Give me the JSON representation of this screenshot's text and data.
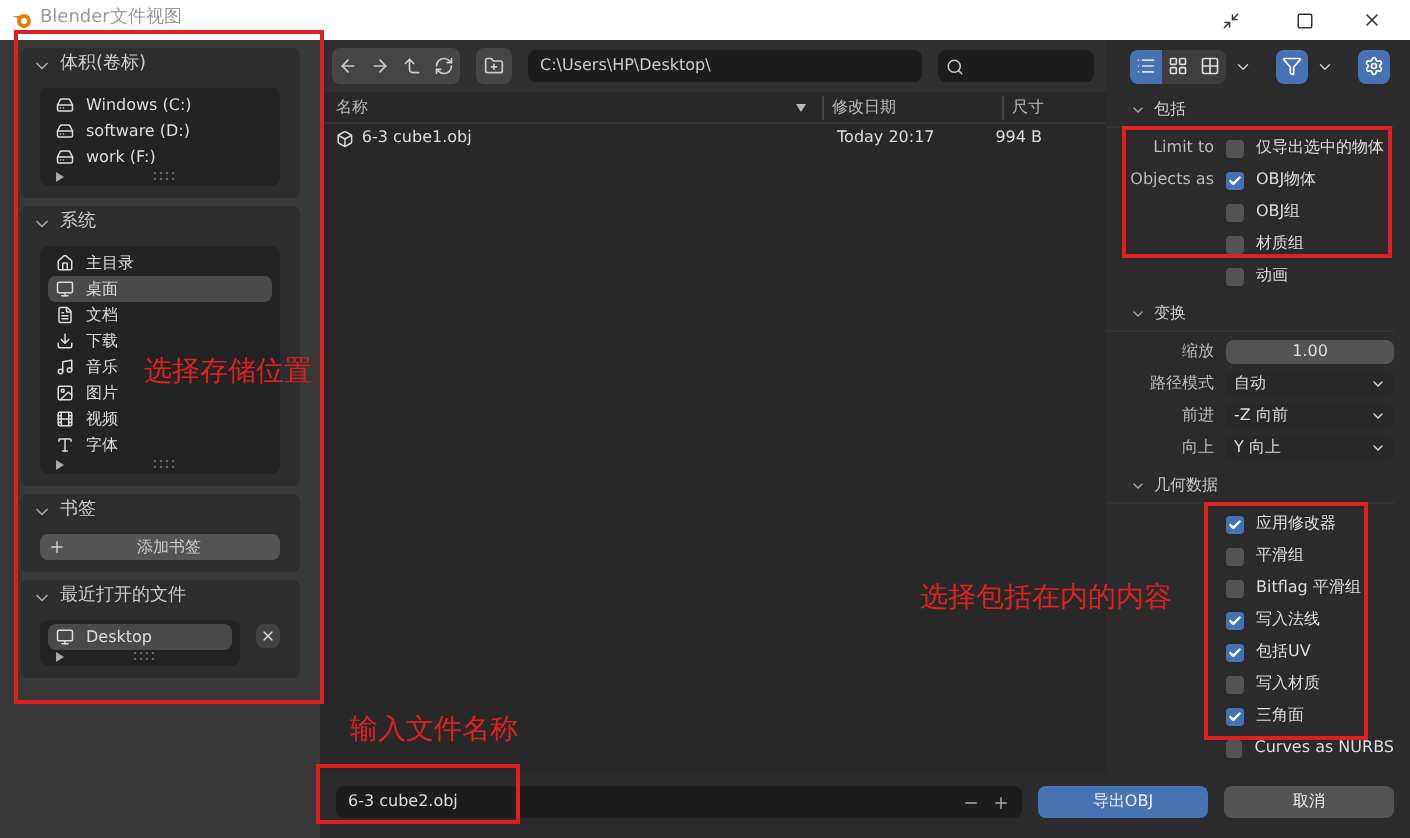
{
  "window": {
    "title": "Blender文件视图"
  },
  "sidebar": {
    "sections": [
      {
        "kind": "list",
        "title": "体积(卷标)",
        "expanded": true,
        "items": [
          {
            "label": "Windows (C:)",
            "selected": false
          },
          {
            "label": "software (D:)",
            "selected": false
          },
          {
            "label": "work (F:)",
            "selected": false
          }
        ]
      },
      {
        "kind": "list",
        "title": "系统",
        "expanded": true,
        "items": [
          {
            "label": "主目录",
            "selected": false
          },
          {
            "label": "桌面",
            "selected": true
          },
          {
            "label": "文档",
            "selected": false
          },
          {
            "label": "下载",
            "selected": false
          },
          {
            "label": "音乐",
            "selected": false
          },
          {
            "label": "图片",
            "selected": false
          },
          {
            "label": "视频",
            "selected": false
          },
          {
            "label": "字体",
            "selected": false
          }
        ]
      },
      {
        "kind": "button",
        "title": "书签",
        "expanded": true,
        "button": "添加书签"
      },
      {
        "kind": "recent",
        "title": "最近打开的文件",
        "expanded": true,
        "items": [
          {
            "label": "Desktop",
            "selected": true
          }
        ]
      }
    ]
  },
  "toolbar": {
    "path": "C:\\Users\\HP\\Desktop\\",
    "view_modes": [
      {
        "kind": "list",
        "selected": true
      },
      {
        "kind": "thumbs-small",
        "selected": false
      },
      {
        "kind": "thumbs",
        "selected": false
      }
    ],
    "filter_on": true
  },
  "table": {
    "columns": [
      "名称",
      "修改日期",
      "尺寸"
    ],
    "rows": [
      [
        "6-3 cube1.obj",
        "Today 20:17",
        "994 B"
      ]
    ]
  },
  "footer": {
    "filename": "6-3 cube2.obj",
    "buttons": [
      {
        "label": "导出OBJ",
        "kind": "primary"
      },
      {
        "label": "取消",
        "kind": "secondary"
      }
    ]
  },
  "options": [
    {
      "title": "包括",
      "rows": [
        {
          "kind": "check",
          "label": "Limit to",
          "text": "仅导出选中的物体",
          "checked": false
        },
        {
          "kind": "check",
          "label": "Objects as",
          "text": "OBJ物体",
          "checked": true
        },
        {
          "kind": "check",
          "text": "OBJ组",
          "checked": false
        },
        {
          "kind": "check",
          "text": "材质组",
          "checked": false
        },
        {
          "kind": "check",
          "text": "动画",
          "checked": false
        }
      ]
    },
    {
      "title": "变换",
      "rows": [
        {
          "kind": "number",
          "label": "缩放",
          "value": "1.00"
        },
        {
          "kind": "select",
          "label": "路径模式",
          "value": "自动"
        },
        {
          "kind": "select",
          "label": "前进",
          "value": "-Z 向前"
        },
        {
          "kind": "select",
          "label": "向上",
          "value": "Y 向上"
        }
      ]
    },
    {
      "title": "几何数据",
      "rows": [
        {
          "kind": "check",
          "text": "应用修改器",
          "checked": true
        },
        {
          "kind": "check",
          "text": "平滑组",
          "checked": false
        },
        {
          "kind": "check",
          "text": "Bitflag 平滑组",
          "checked": false
        },
        {
          "kind": "check",
          "text": "写入法线",
          "checked": true
        },
        {
          "kind": "check",
          "text": "包括UV",
          "checked": true
        },
        {
          "kind": "check",
          "text": "写入材质",
          "checked": false
        },
        {
          "kind": "check",
          "text": "三角面",
          "checked": true
        },
        {
          "kind": "check",
          "text": "Curves as NURBS",
          "checked": false
        }
      ]
    }
  ],
  "annotations": [
    "选择存储位置",
    "选择包括在内的内容",
    "输入文件名称"
  ]
}
